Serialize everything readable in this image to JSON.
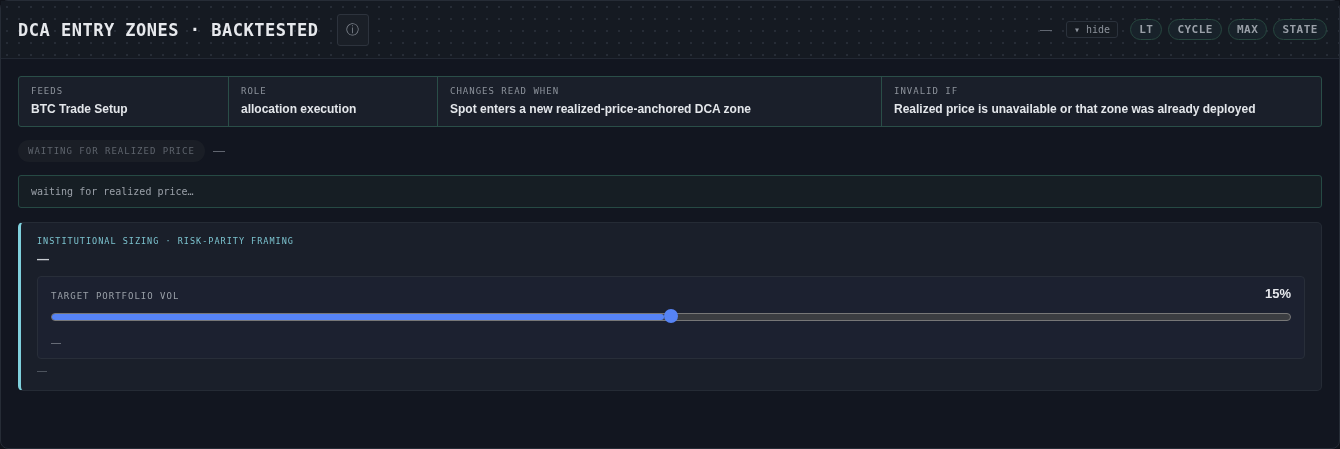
{
  "header": {
    "title": "DCA ENTRY ZONES · BACKTESTED",
    "info_icon": "ⓘ",
    "dash": "—",
    "hide_button": "▾ hide",
    "pills": [
      "LT",
      "CYCLE",
      "MAX",
      "STATE"
    ]
  },
  "facts": [
    {
      "label": "FEEDS",
      "value": "BTC Trade Setup"
    },
    {
      "label": "ROLE",
      "value": "allocation execution"
    },
    {
      "label": "CHANGES READ WHEN",
      "value": "Spot enters a new realized-price-anchored DCA zone"
    },
    {
      "label": "INVALID IF",
      "value": "Realized price is unavailable or that zone was already deployed"
    }
  ],
  "status": {
    "badge": "WAITING FOR REALIZED PRICE",
    "dash": "—"
  },
  "message": "waiting for realized price…",
  "sizing": {
    "title": "INSTITUTIONAL SIZING · RISK-PARITY FRAMING",
    "value": "—",
    "slider": {
      "label": "TARGET PORTFOLIO VOL",
      "reading": "15%",
      "level": 0.5,
      "note": "—"
    },
    "footer": "—"
  }
}
